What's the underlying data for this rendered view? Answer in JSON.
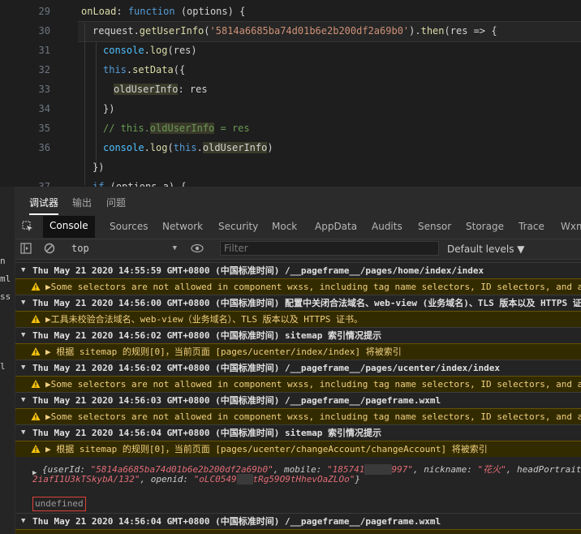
{
  "editor": {
    "lines": [
      {
        "num": "29",
        "text": "onLoad: function (options) {"
      },
      {
        "num": "30",
        "text": "request.getUserInfo('5814a6685ba74d01b6e2b200df2a69b0').then(res => {"
      },
      {
        "num": "31",
        "text": "console.log(res)"
      },
      {
        "num": "32",
        "text": "this.setData({"
      },
      {
        "num": "33",
        "text": "oldUserInfo: res"
      },
      {
        "num": "34",
        "text": "})"
      },
      {
        "num": "35",
        "text": "// this.oldUserInfo = res"
      },
      {
        "num": "36",
        "text": "console.log(this.oldUserInfo)"
      },
      {
        "num": "",
        "text": "})"
      },
      {
        "num": "37",
        "text": "if (options.a) {"
      }
    ]
  },
  "panel_tabs": [
    "调试器",
    "输出",
    "问题"
  ],
  "tool_tabs": [
    "Console",
    "Sources",
    "Network",
    "Security",
    "Mock",
    "AppData",
    "Audits",
    "Sensor",
    "Storage",
    "Trace",
    "Wxml"
  ],
  "filter_bar": {
    "context": "top",
    "filter_placeholder": "Filter",
    "levels": "Default levels ▼"
  },
  "left_edge_fragments": [
    "n",
    "ml",
    "ss",
    "l"
  ],
  "console": {
    "rows": [
      {
        "kind": "group",
        "text": "Thu May 21 2020 14:55:59 GMT+0800 (中国标准时间) /__pageframe__/pages/home/index/index"
      },
      {
        "kind": "warn",
        "text": "▶Some selectors are not allowed in component wxss, including tag name selectors, ID selectors, and attribute selectors.(./components/…"
      },
      {
        "kind": "group",
        "text": "Thu May 21 2020 14:56:00 GMT+0800 (中国标准时间) 配置中关闭合法域名、web-view (业务域名)、TLS 版本以及 HTTPS 证书检查"
      },
      {
        "kind": "warn",
        "text": "▶工具未校验合法域名、web-view（业务域名）、TLS 版本以及 HTTPS 证书。"
      },
      {
        "kind": "group",
        "text": "Thu May 21 2020 14:56:02 GMT+0800 (中国标准时间) sitemap 索引情况提示"
      },
      {
        "kind": "warn",
        "text": "▶ 根据 sitemap 的规则[0]，当前页面 [pages/ucenter/index/index] 将被索引"
      },
      {
        "kind": "group",
        "text": "Thu May 21 2020 14:56:02 GMT+0800 (中国标准时间) /__pageframe__/pages/ucenter/index/index"
      },
      {
        "kind": "warn",
        "text": "▶Some selectors are not allowed in component wxss, including tag name selectors, ID selectors, and attribute selectors.(./components/…"
      },
      {
        "kind": "group",
        "text": "Thu May 21 2020 14:56:03 GMT+0800 (中国标准时间) /__pageframe__/pageframe.wxml"
      },
      {
        "kind": "warn",
        "text": "▶Some selectors are not allowed in component wxss, including tag name selectors, ID selectors, and attribute selectors.(./components/…"
      },
      {
        "kind": "group",
        "text": "Thu May 21 2020 14:56:04 GMT+0800 (中国标准时间) sitemap 索引情况提示"
      },
      {
        "kind": "warn",
        "text": "▶ 根据 sitemap 的规则[0]，当前页面 [pages/ucenter/changeAccount/changeAccount] 将被索引"
      }
    ],
    "object_line1_prefix": "{userId: ",
    "object_userid": "\"5814a6685ba74d01b6e2b200df2a69b0\"",
    "object_mobile_label": ", mobile: ",
    "object_mobile_a": "\"185741",
    "object_mobile_b": "997\"",
    "object_nick_label": ", nickname: ",
    "object_nick": "\"花火\"",
    "object_head_label": ", headPortrait: \"",
    "object_line2_a": "2iafI1U3kTSkybA/132\"",
    "object_openid_label": ", openid: ",
    "object_openid_a": "\"oLC0549",
    "object_openid_b": "tRg59O9tHhevOaZLOo\"",
    "object_close": "}",
    "undefined_text": "undefined",
    "last_group": "Thu May 21 2020 14:56:04 GMT+0800 (中国标准时间) /__pageframe__/pageframe.wxml"
  }
}
